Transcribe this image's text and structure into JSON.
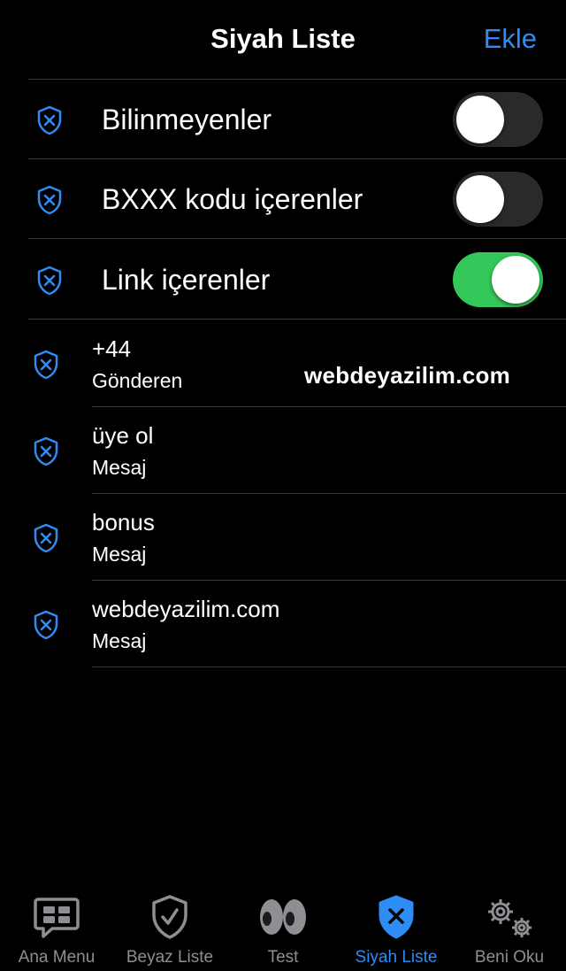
{
  "header": {
    "title": "Siyah Liste",
    "add_label": "Ekle"
  },
  "toggles": [
    {
      "label": "Bilinmeyenler",
      "on": false
    },
    {
      "label": "BXXX kodu içerenler",
      "on": false
    },
    {
      "label": "Link içerenler",
      "on": true
    }
  ],
  "entries": [
    {
      "title": "+44",
      "subtitle": "Gönderen"
    },
    {
      "title": "üye ol",
      "subtitle": "Mesaj"
    },
    {
      "title": "bonus",
      "subtitle": "Mesaj"
    },
    {
      "title": "webdeyazilim.com",
      "subtitle": "Mesaj"
    }
  ],
  "watermark": "webdeyazilim.com",
  "tabs": [
    {
      "label": "Ana Menu",
      "icon": "chat-bubble-icon"
    },
    {
      "label": "Beyaz Liste",
      "icon": "shield-check-icon"
    },
    {
      "label": "Test",
      "icon": "eyes-icon"
    },
    {
      "label": "Siyah Liste",
      "icon": "shield-x-icon",
      "active": true
    },
    {
      "label": "Beni Oku",
      "icon": "gears-icon"
    }
  ],
  "colors": {
    "accent": "#2f8cf5",
    "switch_on": "#34c759",
    "switch_off": "#2a2a2d",
    "inactive_tab": "#8e8e93",
    "divider": "#3a3a3c"
  }
}
